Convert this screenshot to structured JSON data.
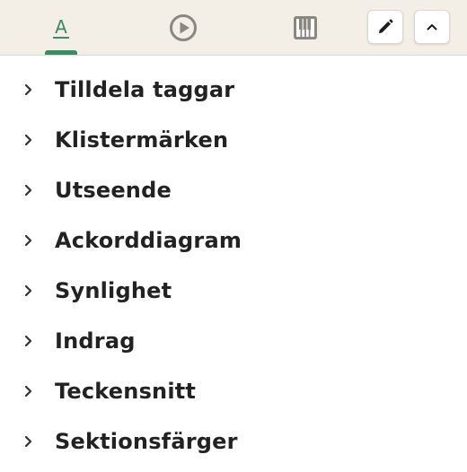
{
  "toolbar": {
    "tabs": [
      {
        "icon": "text-format-icon",
        "label": "A",
        "active": true
      },
      {
        "icon": "play-circle-icon",
        "active": false
      },
      {
        "icon": "piano-keys-icon",
        "active": false
      }
    ],
    "actions": [
      {
        "icon": "pencil-icon"
      },
      {
        "icon": "chevron-up-icon"
      }
    ],
    "accent_color": "#3e8a63",
    "icon_color": "#8a8780"
  },
  "menu": {
    "items": [
      {
        "label": "Tilldela taggar"
      },
      {
        "label": "Klistermärken"
      },
      {
        "label": "Utseende"
      },
      {
        "label": "Ackorddiagram"
      },
      {
        "label": "Synlighet"
      },
      {
        "label": "Indrag"
      },
      {
        "label": "Teckensnitt"
      },
      {
        "label": "Sektionsfärger"
      }
    ]
  }
}
